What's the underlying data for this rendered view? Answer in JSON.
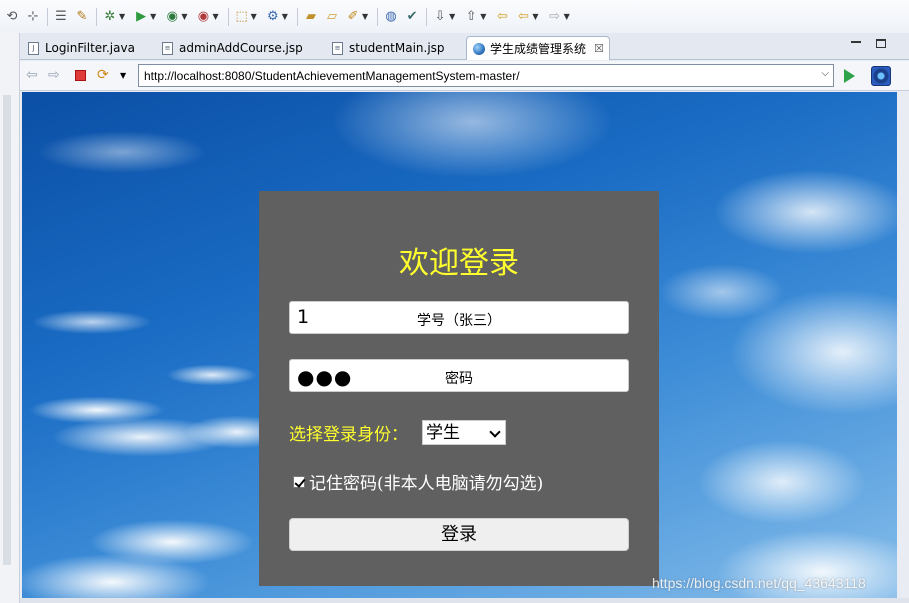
{
  "toolbar": {
    "icons": [
      "toolbar-icon-1",
      "toolbar-icon-2",
      "toolbar-icon-3",
      "debug-icon",
      "run-icon",
      "run-config-icon",
      "external-tools-icon",
      "new-wizard-icon",
      "server-icon",
      "open-type-icon",
      "open-folder-icon",
      "search-icon",
      "globe-icon",
      "task-icon",
      "next-annotation-icon",
      "prev-annotation-icon",
      "last-edit-icon",
      "back-icon",
      "forward-icon"
    ]
  },
  "tabs": [
    {
      "label": "LoginFilter.java",
      "icon": "java-file-icon"
    },
    {
      "label": "adminAddCourse.jsp",
      "icon": "jsp-file-icon"
    },
    {
      "label": "studentMain.jsp",
      "icon": "jsp-file-icon"
    },
    {
      "label": "学生成绩管理系统",
      "icon": "globe-icon",
      "active": true,
      "close": "☒"
    }
  ],
  "browser": {
    "url": "http://localhost:8080/StudentAchievementManagementSystem-master/"
  },
  "login": {
    "title": "欢迎登录",
    "username_value": "1",
    "username_placeholder": "学号（张三）",
    "password_value": "●●●",
    "password_placeholder": "密码",
    "role_label": "选择登录身份：",
    "role_selected": "学生",
    "remember_checked": true,
    "remember_label": "记住密码(非本人电脑请勿勾选)",
    "submit_label": "登录"
  },
  "colors": {
    "panel_bg": "#606060",
    "title_color": "#ffff2e",
    "label_color": "#ffff2e"
  },
  "watermark": "https://blog.csdn.net/qq_43643118"
}
